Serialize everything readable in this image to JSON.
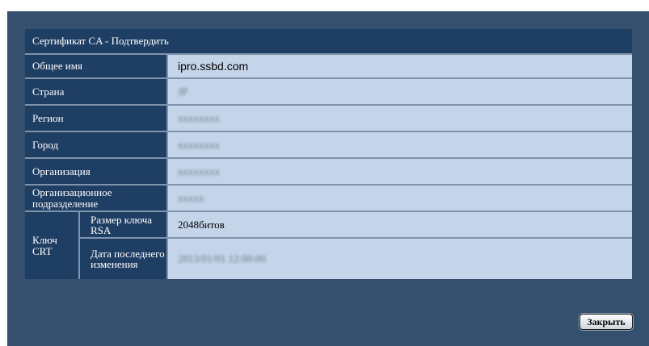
{
  "dialog": {
    "title": "Сертификат CA - Подтвердить",
    "close_label": "Закрыть"
  },
  "fields": {
    "common_name": {
      "label": "Общее имя",
      "value": "ipro.ssbd.com"
    },
    "country": {
      "label": "Страна",
      "value": "JP"
    },
    "region": {
      "label": "Регион",
      "value": "xxxxxxxx"
    },
    "city": {
      "label": "Город",
      "value": "xxxxxxxx"
    },
    "organization": {
      "label": "Организация",
      "value": "xxxxxxxx"
    },
    "org_unit": {
      "label": "Организационное подразделение",
      "value": "xxxxx"
    },
    "crt_key": {
      "label": "Ключ CRT",
      "key_size_label": "Размер ключа RSA",
      "key_size_value": "2048битов",
      "modified_label": "Дата последнего изменения",
      "modified_value": "2013/01/01 12:00:00"
    }
  },
  "colors": {
    "panel_bg": "#35506e",
    "label_bg": "#1f3e63",
    "value_bg": "#c4d5ea",
    "border": "#7f93ad"
  }
}
